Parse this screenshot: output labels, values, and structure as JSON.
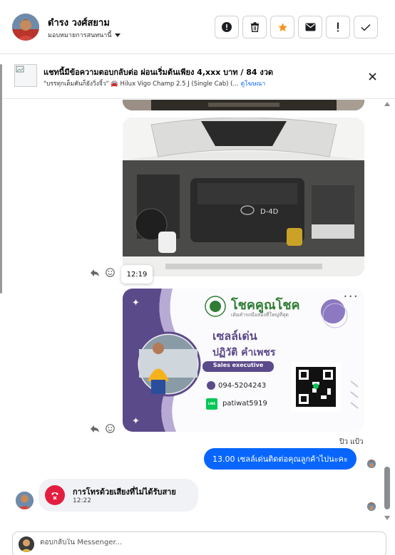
{
  "header": {
    "contact_name": "ดำรง วงศ์สยาม",
    "assign_label": "มอบหมายการสนทนานี้",
    "actions": [
      {
        "icon": "alert-circle-icon"
      },
      {
        "icon": "trash-icon"
      },
      {
        "icon": "star-icon"
      },
      {
        "icon": "envelope-icon"
      },
      {
        "icon": "exclamation-icon"
      },
      {
        "icon": "check-icon"
      }
    ]
  },
  "banner": {
    "title": "แชทนี้มีข้อความตอบกลับต่อ ผ่อนเริ่มต้นเพียง 4,xxx บาท / 84 งวด",
    "subtitle": "\"บรรทุกเต็มคันก็ยังวิ่งจิ้ว\" 🚘 Hilux Vigo Champ 2.5 J (Single Cab) (...",
    "link": "ดูโฆษณา"
  },
  "messages": {
    "hover_time": "12:19",
    "seen_label": "ปิว แป้ว",
    "outgoing_text": "13.00  เซลล์เด่นติดต่อคุณลูกค้าไปนะคะ"
  },
  "business_card": {
    "brand": "โชคคูณโชค",
    "tagline": "เติมคำรถมือสองที่ใหญ่ที่สุด",
    "nickname": "เซลล์เด่น",
    "full_name": "ปฏิวัติ  คำเพชร",
    "position": "Sales executive",
    "phone": "094-5204243",
    "line_badge": "LINE",
    "line_id": "patiwat5919"
  },
  "engine_photo": {
    "badge": "D-4D"
  },
  "call": {
    "title": "การโทรด้วยเสียงที่ไม่ได้รับสาย",
    "time": "12:22"
  },
  "composer": {
    "placeholder": "ตอบกลับใน Messenger..."
  },
  "colors": {
    "accent": "#0866ff",
    "missed_call": "#e41e3f",
    "star": "#f7931e",
    "card_purple": "#5b4a8a"
  }
}
